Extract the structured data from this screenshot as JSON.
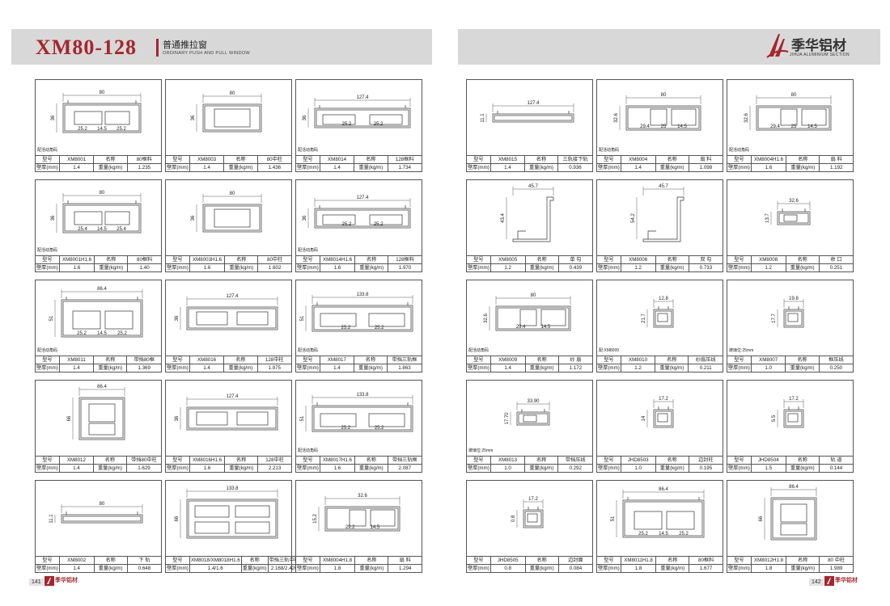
{
  "header": {
    "series": "XM80-128",
    "title_cn": "普通推拉窗",
    "title_en": "ORDINARY PUSH AND PULL WINDOW",
    "brand_cn": "季华铝材",
    "brand_en": "JIHUA ALUMINIUM SECTION"
  },
  "labels": {
    "model": "型号",
    "name": "名称",
    "wall": "壁厚(mm)",
    "weight": "重量(kg/m)"
  },
  "footer": {
    "left_page": "141",
    "right_page": "142",
    "logo_text": "季华铝材"
  },
  "left_cards": [
    {
      "model": "XM8001",
      "name": "80框料",
      "wall": "1.4",
      "weight": "1.235",
      "note": "配活动角码",
      "dims": [
        "80",
        "36",
        "25.2",
        "14.5",
        "25.2"
      ]
    },
    {
      "model": "XM8003",
      "name": "80中柱",
      "wall": "1.4",
      "weight": "1.436",
      "note": "",
      "dims": [
        "80",
        "36"
      ]
    },
    {
      "model": "XM8014",
      "name": "128框料",
      "wall": "1.4",
      "weight": "1.734",
      "note": "配活动角码",
      "dims": [
        "127.4",
        "36",
        "25.2",
        "25.2"
      ]
    },
    {
      "model": "XM8001H1.6",
      "name": "80框料",
      "wall": "1.6",
      "weight": "1.40",
      "note": "配活动角码",
      "dims": [
        "80",
        "36",
        "25.4",
        "14.5",
        "25.4"
      ]
    },
    {
      "model": "XM8003H1.6",
      "name": "80中柱",
      "wall": "1.6",
      "weight": "1.602",
      "note": "",
      "dims": [
        "80",
        "36"
      ]
    },
    {
      "model": "XM8014H1.6",
      "name": "128框料",
      "wall": "1.6",
      "weight": "1.970",
      "note": "配活动角码",
      "dims": [
        "127.4",
        "36",
        "25.2",
        "25.2"
      ]
    },
    {
      "model": "XM8011",
      "name": "带挡80框",
      "wall": "1.4",
      "weight": "1.369",
      "note": "配活动角码",
      "dims": [
        "86.4",
        "51",
        "25.2",
        "14.5",
        "25.2"
      ]
    },
    {
      "model": "XM8016",
      "name": "128中柱",
      "wall": "1.4",
      "weight": "1.975",
      "note": "",
      "dims": [
        "127.4",
        "36"
      ]
    },
    {
      "model": "XM8017",
      "name": "带挡三轨框",
      "wall": "1.4",
      "weight": "1.863",
      "note": "配活动角码",
      "dims": [
        "133.8",
        "51",
        "25.2",
        "25.2"
      ]
    },
    {
      "model": "XM8012",
      "name": "带挡80中柱",
      "wall": "1.4",
      "weight": "1.629",
      "note": "",
      "dims": [
        "86.4",
        "66"
      ]
    },
    {
      "model": "XM8016H1.6",
      "name": "128中柱",
      "wall": "1.6",
      "weight": "2.213",
      "note": "",
      "dims": [
        "127.4",
        "36"
      ]
    },
    {
      "model": "XM8017H1.6",
      "name": "带挡三轨框",
      "wall": "1.6",
      "weight": "2.087",
      "note": "配活动角码",
      "dims": [
        "133.8",
        "51",
        "25.2",
        "25.2"
      ]
    },
    {
      "model": "XM8002",
      "name": "下 轨",
      "wall": "1.4",
      "weight": "0.648",
      "note": "",
      "dims": [
        "80",
        "11.1"
      ]
    },
    {
      "model": "XM8018/XM8018H1.6",
      "name": "带挡三轨中柱",
      "wall": "1.4/1.6",
      "weight": "2.168/2.420",
      "note": "",
      "dims": [
        "133.8",
        "66"
      ]
    },
    {
      "model": "XM8004H1.8",
      "name": "扇 料",
      "wall": "1.8",
      "weight": "1.294",
      "note": "",
      "dims": [
        "32.6",
        "15.2",
        "29.2",
        "14.5"
      ]
    }
  ],
  "right_cards": [
    {
      "model": "XM8015",
      "name": "三轨接下轨",
      "wall": "1.4",
      "weight": "0.936",
      "note": "",
      "dims": [
        "127.4",
        "11.1"
      ]
    },
    {
      "model": "XM8004",
      "name": "扇 料",
      "wall": "1.4",
      "weight": "1.098",
      "note": "配活动角码",
      "dims": [
        "80",
        "32.6",
        "29.4",
        "25",
        "14.5"
      ]
    },
    {
      "model": "XM8004H1.6",
      "name": "扇 料",
      "wall": "1.6",
      "weight": "1.192",
      "note": "配活动角码",
      "dims": [
        "80",
        "32.6",
        "29.4",
        "25",
        "14.5"
      ]
    },
    {
      "model": "XM8005",
      "name": "单 勾",
      "wall": "1.2",
      "weight": "0.439",
      "note": "",
      "dims": [
        "45.7",
        "43.4"
      ]
    },
    {
      "model": "XM8006",
      "name": "双 勾",
      "wall": "1.2",
      "weight": "0.733",
      "note": "",
      "dims": [
        "45.7",
        "54.2"
      ]
    },
    {
      "model": "XM8008",
      "name": "收 口",
      "wall": "1.2",
      "weight": "0.251",
      "note": "",
      "dims": [
        "32.6",
        "13.7"
      ]
    },
    {
      "model": "XM8009",
      "name": "纱 扇",
      "wall": "1.4",
      "weight": "1.172",
      "note": "配活动角码",
      "dims": [
        "80",
        "32.6",
        "29.4",
        "14.5"
      ]
    },
    {
      "model": "XM8010",
      "name": "纱扇压线",
      "wall": "1.2",
      "weight": "0.211",
      "note": "配:XM8009",
      "dims": [
        "12.8",
        "21.7"
      ]
    },
    {
      "model": "XM8007",
      "name": "框压线",
      "wall": "1.0",
      "weight": "0.250",
      "note": "玻璃位:25mm",
      "dims": [
        "19.8",
        "17.7"
      ]
    },
    {
      "model": "XM8013",
      "name": "带挡压线",
      "wall": "1.0",
      "weight": "0.292",
      "note": "玻璃位:25mm",
      "dims": [
        "33.90",
        "17.70"
      ]
    },
    {
      "model": "JHD8503",
      "name": "边封柱",
      "wall": "1.0",
      "weight": "0.195",
      "note": "",
      "dims": [
        "17.2",
        "14"
      ]
    },
    {
      "model": "JHD8504",
      "name": "轨 道",
      "wall": "1.5",
      "weight": "0.144",
      "note": "",
      "dims": [
        "17.2",
        "5.5"
      ]
    },
    {
      "model": "JHD8505",
      "name": "边封面",
      "wall": "0.8",
      "weight": "0.084",
      "note": "",
      "dims": [
        "17.2",
        "0.8"
      ]
    },
    {
      "model": "XM8011H1.8",
      "name": "80框料",
      "wall": "1.8",
      "weight": "1.677",
      "note": "",
      "dims": [
        "86.4",
        "51",
        "25.2",
        "14.5",
        "25.2"
      ]
    },
    {
      "model": "XM8012H1.8",
      "name": "80 中柱",
      "wall": "1.8",
      "weight": "1.989",
      "note": "",
      "dims": [
        "86.4",
        "66"
      ]
    }
  ]
}
